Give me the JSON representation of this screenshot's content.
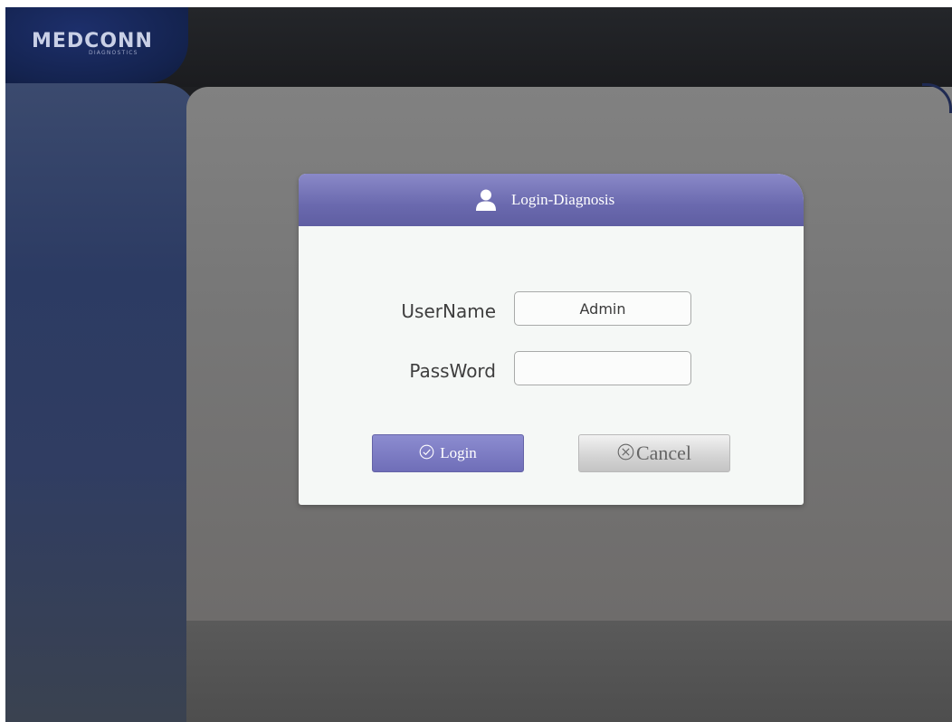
{
  "brand": {
    "name": "MEDCONN",
    "tagline": "DIAGNOSTICS"
  },
  "dialog": {
    "title": "Login-Diagnosis",
    "title_icon": "user-icon",
    "username_label": "UserName",
    "username_value": "Admin",
    "password_label": "PassWord",
    "password_value": "",
    "login_icon": "check-circle-icon",
    "login_label": "Login",
    "cancel_icon": "x-circle-icon",
    "cancel_label": "Cancel"
  },
  "colors": {
    "accent": "#6f6eb8",
    "sidebar": "#2c3b63",
    "logo_bg": "#14234f"
  }
}
